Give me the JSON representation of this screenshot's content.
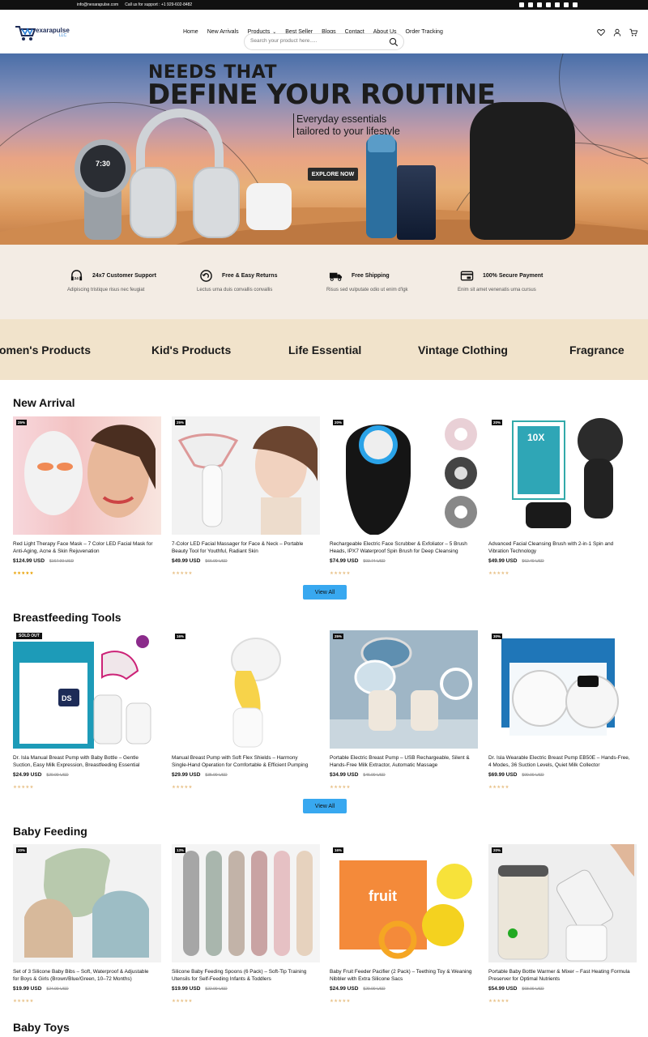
{
  "top_bar": {
    "email": "info@nexarapulse.com",
    "support": "Call us for support : +1 929-602-8482",
    "social_icons": [
      "facebook-icon",
      "instagram-icon",
      "linkedin-icon",
      "x-icon",
      "youtube-icon",
      "tiktok-icon",
      "pinterest-icon"
    ]
  },
  "header": {
    "logo_text": "exarapulse",
    "logo_suffix": "LLC",
    "nav": [
      "Home",
      "New Arrivals",
      "Products",
      "Best Seller",
      "Blogs",
      "Contact",
      "About Us",
      "Order Tracking"
    ],
    "search_placeholder": "Search your product here.....",
    "icons": [
      "heart-icon",
      "user-icon",
      "cart-icon"
    ]
  },
  "hero": {
    "headline_1": "NEEDS THAT",
    "headline_2": "DEFINE YOUR ROUTINE",
    "copy": "Everyday essentials tailored to your lifestyle",
    "button": "EXPLORE NOW",
    "watch_time": "7:30"
  },
  "features": [
    {
      "title": "24x7 Customer Support",
      "desc": "Adipiscing tristique risus nec feugiat",
      "icon": "headset-icon"
    },
    {
      "title": "Free & Easy Returns",
      "desc": "Lectus urna duis convallis convallis",
      "icon": "return-icon"
    },
    {
      "title": "Free Shipping",
      "desc": "Risus sed vulputate odio ut enim d'lgk",
      "icon": "truck-icon"
    },
    {
      "title": "100% Secure Payment",
      "desc": "Enim sit amet venenatis urna cursus",
      "icon": "payment-icon"
    }
  ],
  "categories": [
    "Women's Products",
    "Kid's Products",
    "Life Essential",
    "Vintage Clothing",
    "Fragrance"
  ],
  "sections": [
    {
      "title": "New Arrival",
      "view_all": "View All",
      "products": [
        {
          "badge": "25%",
          "name": "Red Light Therapy Face Mask – 7 Color LED Facial Mask for Anti-Aging, Acne & Skin Rejuvenation",
          "price": "$124.99 USD",
          "old": "$167.99 USD",
          "stars": "★★★★★",
          "rated": true
        },
        {
          "badge": "25%",
          "name": "7-Color LED Facial Massager for Face & Neck – Portable Beauty Tool for Youthful, Radiant Skin",
          "price": "$49.99 USD",
          "old": "$66.99 USD",
          "stars": "★★★★★",
          "rated": false
        },
        {
          "badge": "20%",
          "name": "Rechargeable Electric Face Scrubber & Exfoliator – 5 Brush Heads, IPX7 Waterproof Spin Brush for Deep Cleansing",
          "price": "$74.99 USD",
          "old": "$93.74 USD",
          "stars": "★★★★★",
          "rated": false
        },
        {
          "badge": "20%",
          "name": "Advanced Facial Cleansing Brush with 2-in-1 Spin and Vibration Technology",
          "price": "$49.99 USD",
          "old": "$62.49 USD",
          "stars": "★★★★★",
          "rated": false
        }
      ]
    },
    {
      "title": "Breastfeeding Tools",
      "view_all": "View All",
      "products": [
        {
          "badge": "SOLD OUT",
          "name": "Dr. Isla Manual Breast Pump with Baby Bottle – Gentle Suction, Easy Milk Expression, Breastfeeding Essential",
          "price": "$24.99 USD",
          "old": "$29.99 USD",
          "stars": "★★★★★",
          "rated": false
        },
        {
          "badge": "16%",
          "name": "Manual Breast Pump with Soft Flex Shields – Harmony Single-Hand Operation for Comfortable & Efficient Pumping",
          "price": "$29.99 USD",
          "old": "$35.99 USD",
          "stars": "★★★★★",
          "rated": false
        },
        {
          "badge": "25%",
          "name": "Portable Electric Breast Pump – USB Rechargeable, Silent & Hands-Free Milk Extractor, Automatic Massage",
          "price": "$34.99 USD",
          "old": "$46.99 USD",
          "stars": "★★★★★",
          "rated": false
        },
        {
          "badge": "30%",
          "name": "Dr. Isla Wearable Electric Breast Pump EB50E – Hands-Free, 4 Modes, 36 Suction Levels, Quiet Milk Collector",
          "price": "$69.99 USD",
          "old": "$99.99 USD",
          "stars": "★★★★★",
          "rated": false
        }
      ]
    },
    {
      "title": "Baby Feeding",
      "view_all": "View All",
      "products": [
        {
          "badge": "20%",
          "name": "Set of 3 Silicone Baby Bibs – Soft, Waterproof & Adjustable for Boys & Girls (Brown/Blue/Green, 10–72 Months)",
          "price": "$19.99 USD",
          "old": "$24.99 USD",
          "stars": "★★★★★",
          "rated": false
        },
        {
          "badge": "13%",
          "name": "Silicone Baby Feeding Spoons (6 Pack) – Soft-Tip Training Utensils for Self-Feeding Infants & Toddlers",
          "price": "$19.99 USD",
          "old": "$22.99 USD",
          "stars": "★★★★★",
          "rated": false
        },
        {
          "badge": "16%",
          "name": "Baby Fruit Feeder Pacifier (2 Pack) – Teething Toy & Weaning Nibbler with Extra Silicone Sacs",
          "price": "$24.99 USD",
          "old": "$29.99 USD",
          "stars": "★★★★★",
          "rated": false
        },
        {
          "badge": "20%",
          "name": "Portable Baby Bottle Warmer & Mixer – Fast Heating Formula Preserver for Optimal Nutrients",
          "price": "$54.99 USD",
          "old": "$68.99 USD",
          "stars": "★★★★★",
          "rated": false
        }
      ]
    },
    {
      "title": "Baby Toys"
    }
  ]
}
